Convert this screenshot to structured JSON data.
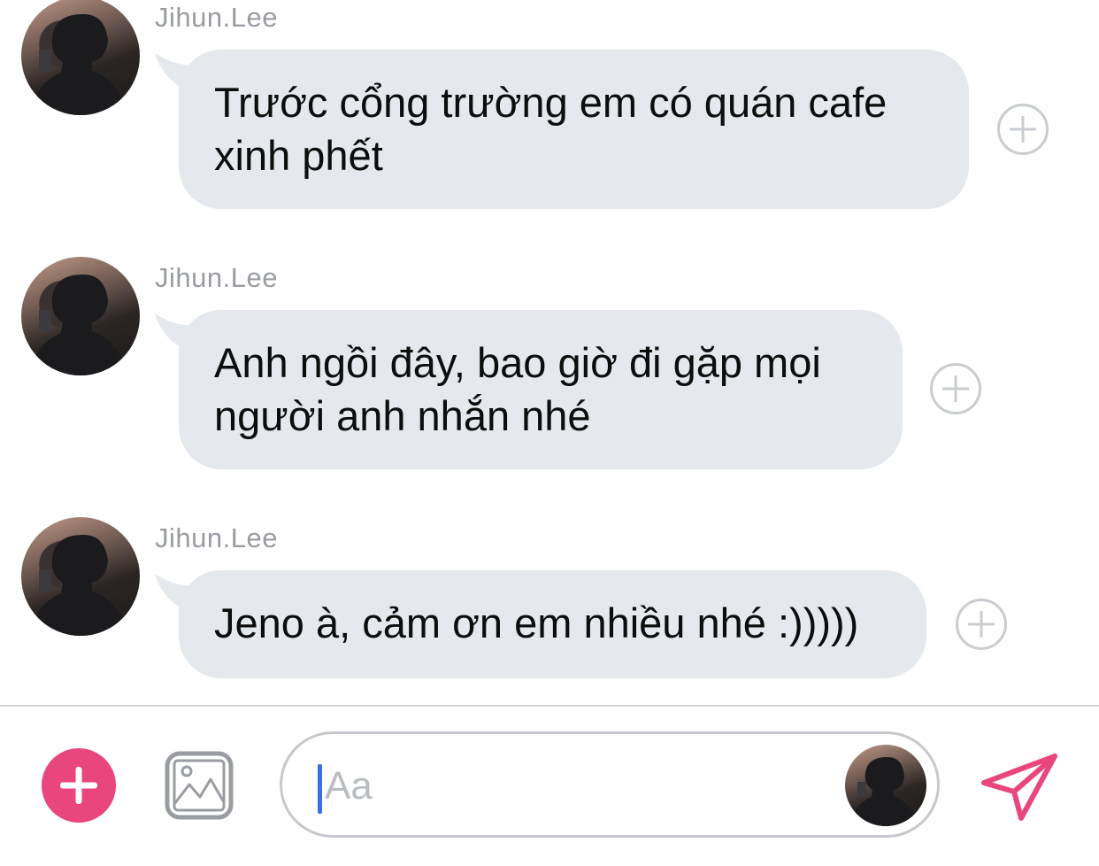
{
  "messages": [
    {
      "sender": "Jihun.Lee",
      "lines": [
        "Trước cổng trường em có quán cafe",
        "xinh phết"
      ]
    },
    {
      "sender": "Jihun.Lee",
      "lines": [
        "Anh ngồi đây, bao giờ đi gặp mọi",
        "người anh nhắn nhé"
      ]
    },
    {
      "sender": "Jihun.Lee",
      "lines": [
        "Jeno à, cảm ơn em nhiều nhé :)))))"
      ]
    }
  ],
  "composer": {
    "placeholder": "Aa"
  },
  "colors": {
    "bubble": "#e5e8ec",
    "accent_pink": "#e8467d",
    "caret": "#3b6fe0"
  },
  "icons": [
    "avatar",
    "add-reaction-icon",
    "plus-icon",
    "image-icon",
    "send-icon"
  ]
}
